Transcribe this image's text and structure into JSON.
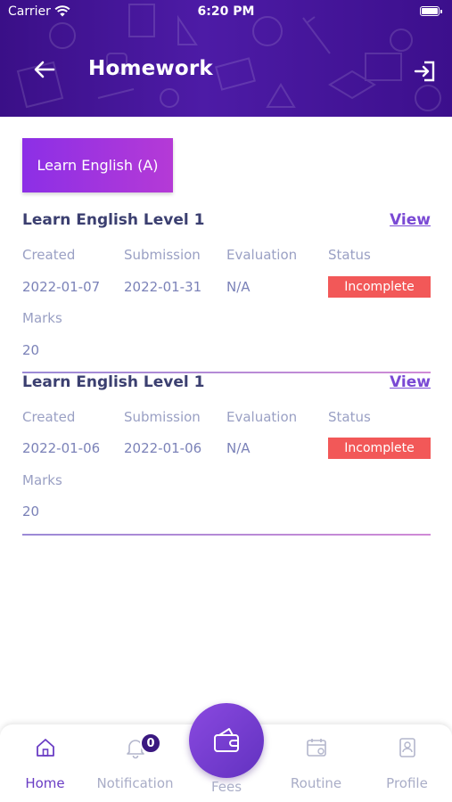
{
  "status_bar": {
    "carrier": "Carrier",
    "time": "6:20 PM"
  },
  "header": {
    "title": "Homework"
  },
  "class_chip": {
    "label": "Learn English (A)"
  },
  "labels": {
    "created": "Created",
    "submission": "Submission",
    "evaluation": "Evaluation",
    "status": "Status",
    "marks": "Marks",
    "view": "View"
  },
  "homework": [
    {
      "title": "Learn English Level 1",
      "created": "2022-01-07",
      "submission": "2022-01-31",
      "evaluation": "N/A",
      "status": "Incomplete",
      "marks": "20"
    },
    {
      "title": "Learn English Level 1",
      "created": "2022-01-06",
      "submission": "2022-01-06",
      "evaluation": "N/A",
      "status": "Incomplete",
      "marks": "20"
    }
  ],
  "bottom_nav": {
    "items": [
      {
        "label": "Home",
        "icon": "home-icon",
        "active": true
      },
      {
        "label": "Notification",
        "icon": "bell-icon",
        "badge": "0"
      },
      {
        "label": "Fees",
        "icon": "wallet-icon"
      },
      {
        "label": "Routine",
        "icon": "calendar-icon"
      },
      {
        "label": "Profile",
        "icon": "profile-card-icon"
      }
    ]
  },
  "colors": {
    "header": "#3f1296",
    "accent": "#6a3dc4",
    "status_incomplete": "#f25858",
    "chip": "#9b34e0"
  }
}
